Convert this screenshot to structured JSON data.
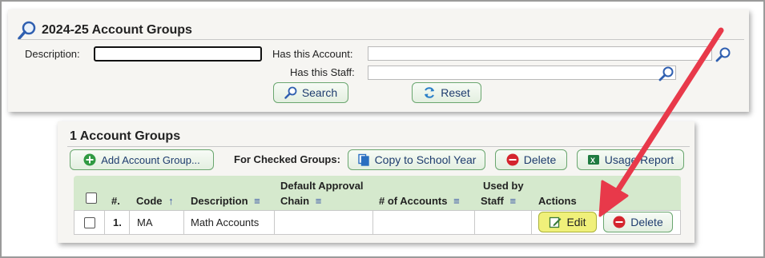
{
  "search": {
    "title": "2024-25 Account Groups",
    "description_label": "Description:",
    "description_value": "",
    "has_account_label": "Has this Account:",
    "has_account_value": "",
    "has_staff_label": "Has this Staff:",
    "has_staff_value": "",
    "search_button": "Search",
    "reset_button": "Reset"
  },
  "grid": {
    "title": "1 Account Groups",
    "add_button": "Add Account Group...",
    "checked_label": "For Checked Groups:",
    "copy_button": "Copy to School Year",
    "delete_button": "Delete",
    "usage_button": "Usage Report",
    "columns": {
      "num": "#.",
      "code": "Code",
      "code_sort": "↑",
      "description": "Description",
      "approval_1": "Default Approval",
      "approval_2": "Chain",
      "accounts": "# of Accounts",
      "used_1": "Used by",
      "used_2": "Staff",
      "actions": "Actions",
      "filter": "≡"
    },
    "rows": [
      {
        "num": "1.",
        "code": "MA",
        "description": "Math Accounts",
        "approval": "",
        "accounts": "",
        "staff": "",
        "edit": "Edit",
        "delete": "Delete"
      }
    ]
  },
  "colors": {
    "accent_red": "#e8394a",
    "header_green": "#d5e9cd",
    "button_text": "#1e3c6e",
    "edit_yellow": "#f0f07a"
  }
}
